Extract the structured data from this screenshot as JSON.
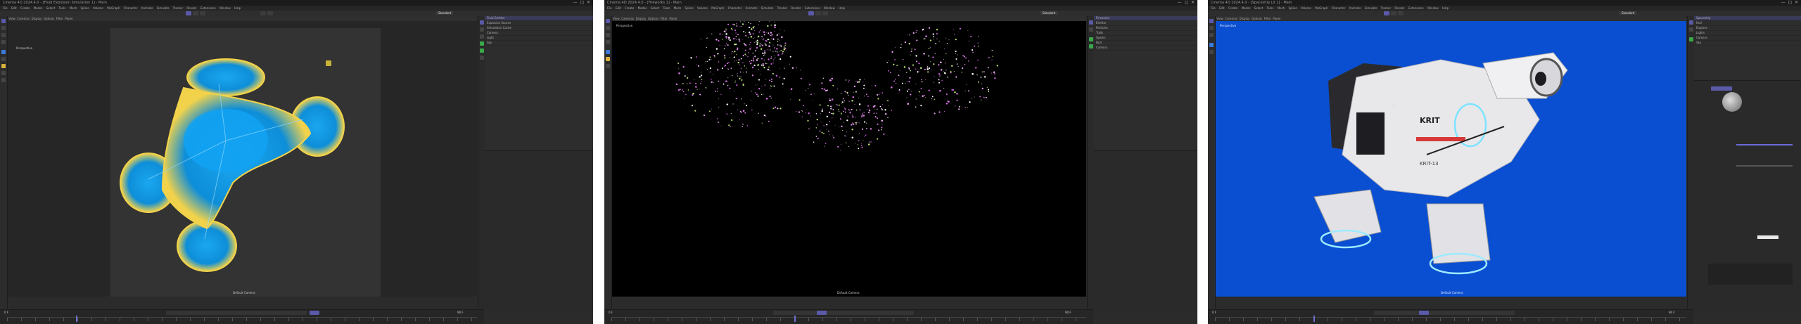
{
  "windows": [
    {
      "title": "Cinema 4D 2024.4.0 - [Fluid Explosion Simulation 1] - Main",
      "menus": [
        "File",
        "Edit",
        "Create",
        "Modes",
        "Select",
        "Tools",
        "Mesh",
        "Spline",
        "Volume",
        "MoGraph",
        "Character",
        "Animate",
        "Simulate",
        "Tracker",
        "Render",
        "Extensions",
        "Window",
        "Help"
      ],
      "layout_tab": "Standard",
      "viewport_label": "Perspective",
      "viewport_status": "Default Camera",
      "timeline_start": "0 F",
      "timeline_end": "90 F",
      "current_frame": "30 F",
      "objects": [
        "Fluid Emitter",
        "Explosion Source",
        "Simulation Cache",
        "Camera",
        "Light",
        "Sky"
      ]
    },
    {
      "title": "Cinema 4D 2024.4.0 - [Fireworks 1] - Main",
      "menus": [
        "File",
        "Edit",
        "Create",
        "Modes",
        "Select",
        "Tools",
        "Mesh",
        "Spline",
        "Volume",
        "MoGraph",
        "Character",
        "Animate",
        "Simulate",
        "Tracker",
        "Render",
        "Extensions",
        "Window",
        "Help"
      ],
      "layout_tab": "Standard",
      "viewport_label": "Perspective",
      "viewport_status": "Default Camera",
      "timeline_start": "0 F",
      "timeline_end": "90 F",
      "current_frame": "40 F",
      "objects": [
        "Fireworks",
        "Emitter",
        "Particles",
        "Trails",
        "Sparks",
        "Null",
        "Camera"
      ]
    },
    {
      "title": "Cinema 4D 2024.4.0 - [Spaceship Lit 1] - Main",
      "menus": [
        "File",
        "Edit",
        "Create",
        "Modes",
        "Select",
        "Tools",
        "Mesh",
        "Spline",
        "Volume",
        "MoGraph",
        "Character",
        "Animate",
        "Simulate",
        "Tracker",
        "Render",
        "Extensions",
        "Window",
        "Help"
      ],
      "layout_tab": "Standard",
      "viewport_label": "Perspective",
      "viewport_status": "Default Camera",
      "timeline_start": "0 F",
      "timeline_end": "90 F",
      "current_frame": "25 F",
      "objects": [
        "Spaceship",
        "Hull",
        "Engines",
        "Lights",
        "Camera",
        "Sky"
      ],
      "ship_markings": [
        "KRIT",
        "KRIT-13",
        "13"
      ]
    }
  ],
  "colors": {
    "accent": "#6a6ad8",
    "viewport_bg": "#333333",
    "blue_bg": "#0a4fd1",
    "fluid_blue": "#1aa7f0",
    "fluid_yellow": "#f2d24a",
    "firework_pink": "#d77be0",
    "ship_hull": "#e8e8ea"
  }
}
